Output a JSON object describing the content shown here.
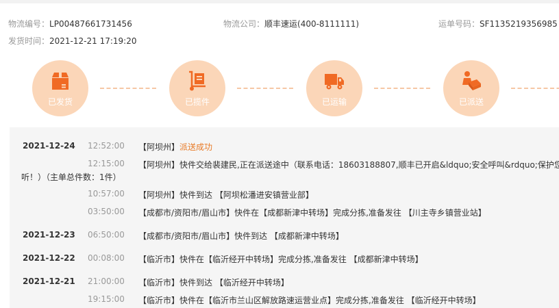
{
  "info": {
    "logistics_no_label": "物流编号：",
    "logistics_no_value": "LP00487661731456",
    "company_label": "物流公司：",
    "company_value": "顺丰速运(400-8111111)",
    "waybill_label": "运单号码：",
    "waybill_value": "SF1135219356985",
    "ship_time_label": "发货时间：",
    "ship_time_value": "2021-12-21 17:19:20"
  },
  "steps": [
    {
      "label": "已发货",
      "icon": "box-icon"
    },
    {
      "label": "已揽件",
      "icon": "hand-truck-icon"
    },
    {
      "label": "已运输",
      "icon": "truck-icon"
    },
    {
      "label": "已派送",
      "icon": "courier-icon"
    }
  ],
  "colors": {
    "accent": "#e87a26",
    "step_circle": "#fbd6b8",
    "icon": "#f06a24",
    "track_bg": "#f5f5f5"
  },
  "track": [
    {
      "date": "2021-12-24",
      "time": "12:52:00",
      "desc_pre": "【阿坝州】",
      "desc_hl": "派送成功",
      "desc_post": ""
    },
    {
      "date": "",
      "time": "12:15:00",
      "desc_pre": "【阿坝州】快件交给裴建民,正在派送途中（联系电话：18603188807,顺丰已开启&ldquo;安全呼叫&rdquo;保护您的",
      "desc_hl": "",
      "desc_post": "",
      "wrap": "听！）（主单总件数：1件）"
    },
    {
      "date": "",
      "time": "10:57:00",
      "desc_pre": "【阿坝州】快件到达 【阿坝松潘进安镇营业部】",
      "desc_hl": "",
      "desc_post": ""
    },
    {
      "date": "",
      "time": "03:50:00",
      "desc_pre": "【成都市/资阳市/眉山市】快件在【成都新津中转场】完成分拣,准备发往 【川主寺乡镇营业站】",
      "desc_hl": "",
      "desc_post": ""
    },
    {
      "date": "2021-12-23",
      "time": "06:50:00",
      "desc_pre": "【成都市/资阳市/眉山市】快件到达 【成都新津中转场】",
      "desc_hl": "",
      "desc_post": ""
    },
    {
      "date": "2021-12-22",
      "time": "00:08:00",
      "desc_pre": "【临沂市】快件在【临沂经开中转场】完成分拣,准备发往 【成都新津中转场】",
      "desc_hl": "",
      "desc_post": ""
    },
    {
      "date": "2021-12-21",
      "time": "21:00:00",
      "desc_pre": "【临沂市】快件到达 【临沂经开中转场】",
      "desc_hl": "",
      "desc_post": ""
    },
    {
      "date": "",
      "time": "19:15:00",
      "desc_pre": "【临沂市】快件在【临沂市兰山区解放路速运营业点】完成分拣,准备发往 【临沂经开中转场】",
      "desc_hl": "",
      "desc_post": ""
    }
  ]
}
